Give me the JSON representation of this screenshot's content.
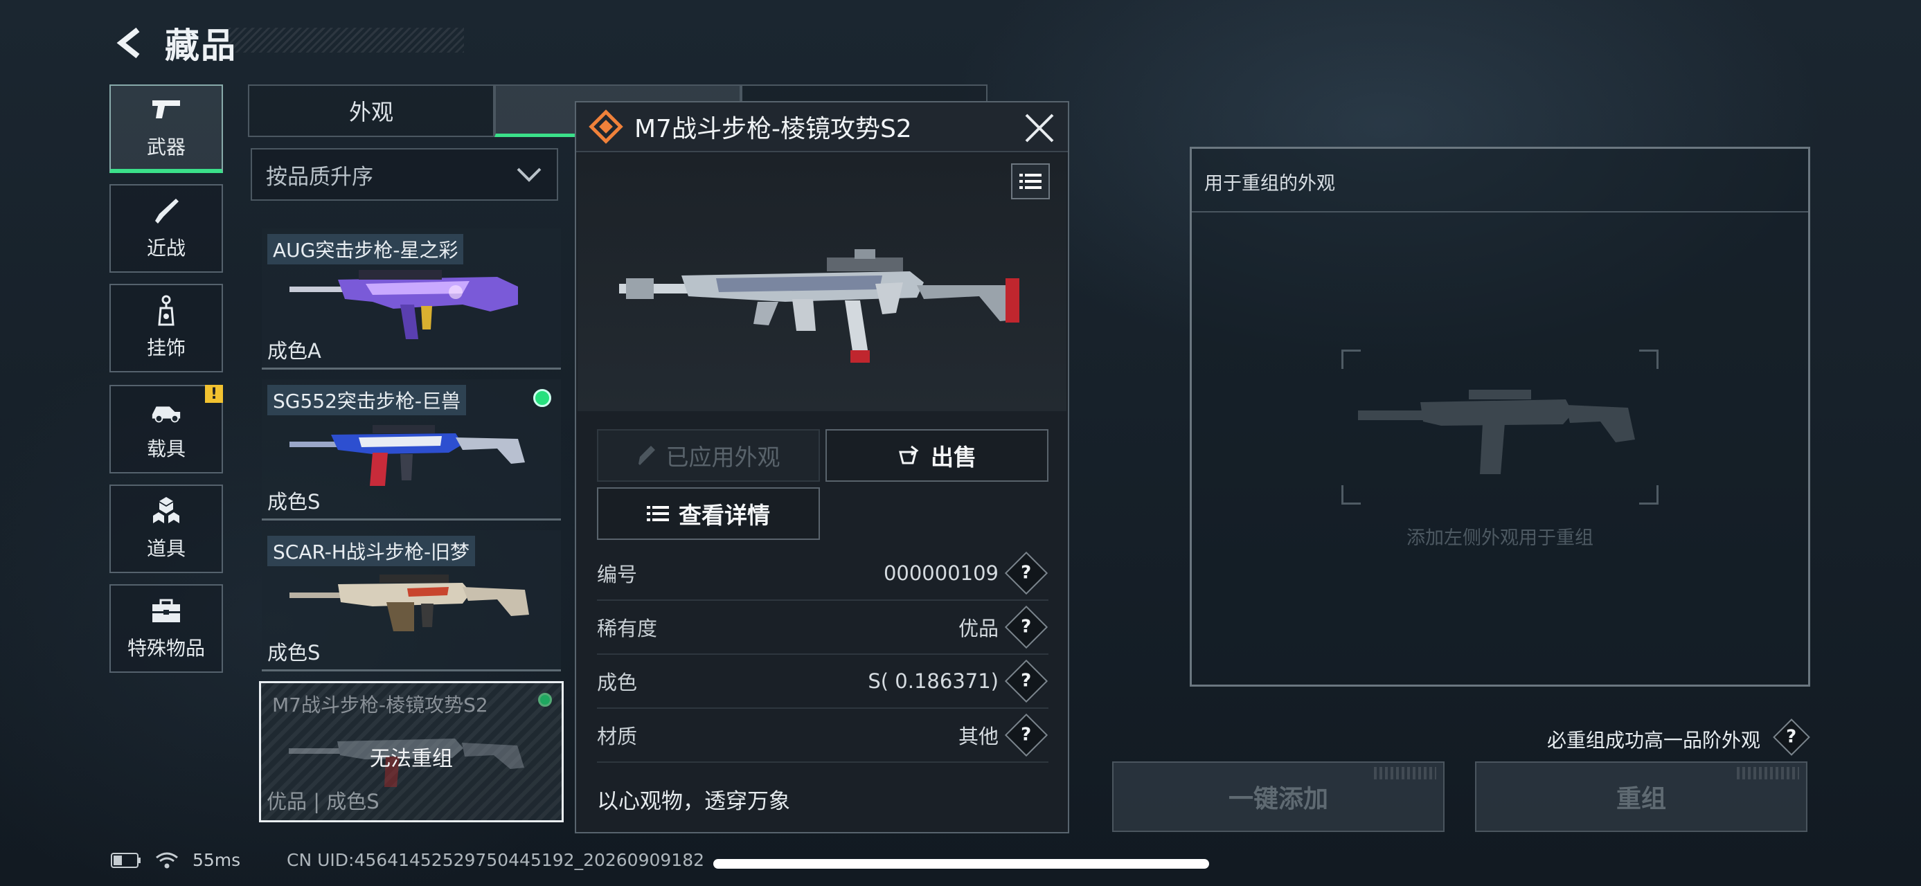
{
  "header": {
    "title": "藏品"
  },
  "categories": [
    {
      "label": "武器",
      "icon": "pistol-icon",
      "active": true
    },
    {
      "label": "近战",
      "icon": "knife-icon"
    },
    {
      "label": "挂饰",
      "icon": "charm-icon"
    },
    {
      "label": "载具",
      "icon": "vehicle-icon",
      "badge": "!"
    },
    {
      "label": "道具",
      "icon": "cubes-icon"
    },
    {
      "label": "特殊物品",
      "icon": "toolbox-icon"
    }
  ],
  "tabs": [
    {
      "label": "外观"
    },
    {
      "label": ""
    },
    {
      "label": ""
    }
  ],
  "sort": {
    "label": "按品质升序"
  },
  "skins": [
    {
      "name": "AUG突击步枪-星之彩",
      "condition": "成色A"
    },
    {
      "name": "SG552突击步枪-巨兽",
      "condition": "成色S"
    },
    {
      "name": "SCAR-H战斗步枪-旧梦",
      "condition": "成色S"
    },
    {
      "name": "M7战斗步枪-棱镜攻势S2",
      "condition": "优品 | 成色S",
      "overlay": "无法重组"
    }
  ],
  "detail": {
    "title": "M7战斗步枪-棱镜攻势S2",
    "applied_label": "已应用外观",
    "sell_label": "出售",
    "view_details_label": "查看详情",
    "rows": [
      {
        "key": "编号",
        "value": "000000109"
      },
      {
        "key": "稀有度",
        "value": "优品"
      },
      {
        "key": "成色",
        "value": "S( 0.186371)"
      },
      {
        "key": "材质",
        "value": "其他"
      }
    ],
    "motto": "以心观物，透穿万象"
  },
  "recombine": {
    "header": "用于重组的外观",
    "hint": "添加左侧外观用于重组",
    "must_text": "必重组成功高一品阶外观",
    "add_all_label": "一键添加",
    "recombine_label": "重组"
  },
  "status": {
    "ping": "55ms",
    "uid": "CN UID:45641452529750445192_20260909182"
  },
  "colors": {
    "accent": "#3be08a",
    "warning": "#f2c230"
  }
}
